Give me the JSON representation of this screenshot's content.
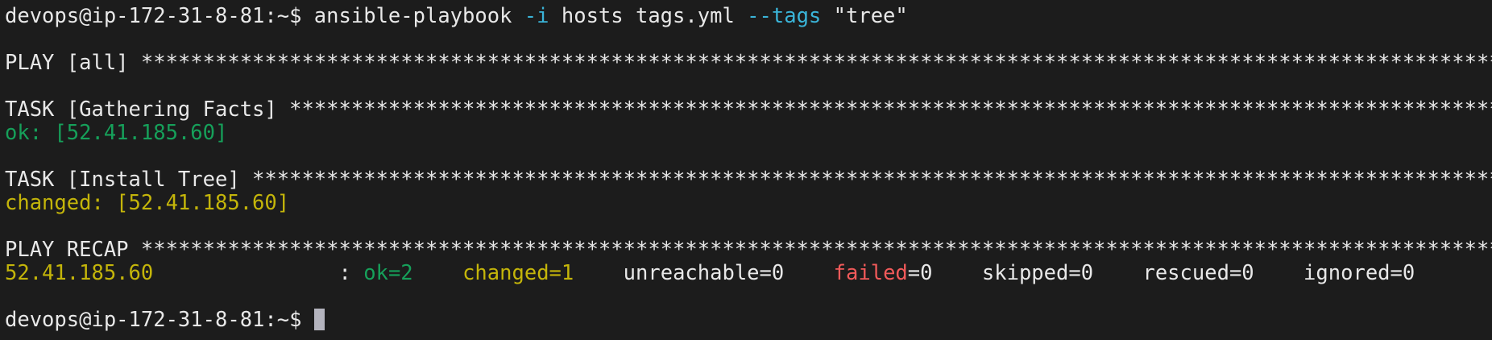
{
  "colors": {
    "background": "#1c1c1c",
    "text": "#e8e8e8",
    "ok": "#16a05a",
    "changed": "#c4b50a",
    "failed": "#f25a5a",
    "option": "#3ab4d8",
    "cursor": "#b4b4be"
  },
  "lines": [
    [
      {
        "t": "devops@ip-172-31-8-81:~$ ansible-playbook "
      },
      {
        "t": "-i",
        "c": "option"
      },
      {
        "t": " hosts tags.yml "
      },
      {
        "t": "--tags",
        "c": "option"
      },
      {
        "t": " \"tree\""
      }
    ],
    [],
    [
      {
        "t": "PLAY [all] ",
        "stars": true
      }
    ],
    [],
    [
      {
        "t": "TASK [Gathering Facts] ",
        "stars": true
      }
    ],
    [
      {
        "t": "ok: [52.41.185.60]",
        "c": "ok"
      }
    ],
    [],
    [
      {
        "t": "TASK [Install Tree] ",
        "stars": true
      }
    ],
    [
      {
        "t": "changed: [52.41.185.60]",
        "c": "changed"
      }
    ],
    [],
    [
      {
        "t": "PLAY RECAP ",
        "stars": true
      }
    ],
    [
      {
        "t": "52.41.185.60              ",
        "c": "changed"
      },
      {
        "t": " : "
      },
      {
        "t": "ok=2",
        "c": "ok"
      },
      {
        "t": "    "
      },
      {
        "t": "changed=1",
        "c": "changed"
      },
      {
        "t": "    unreachable=0    "
      },
      {
        "t": "failed",
        "c": "failed"
      },
      {
        "t": "=0    skipped=0    rescued=0    ignored=0"
      }
    ],
    [],
    [
      {
        "t": "devops@ip-172-31-8-81:~$ "
      },
      {
        "cursor": true
      }
    ]
  ]
}
